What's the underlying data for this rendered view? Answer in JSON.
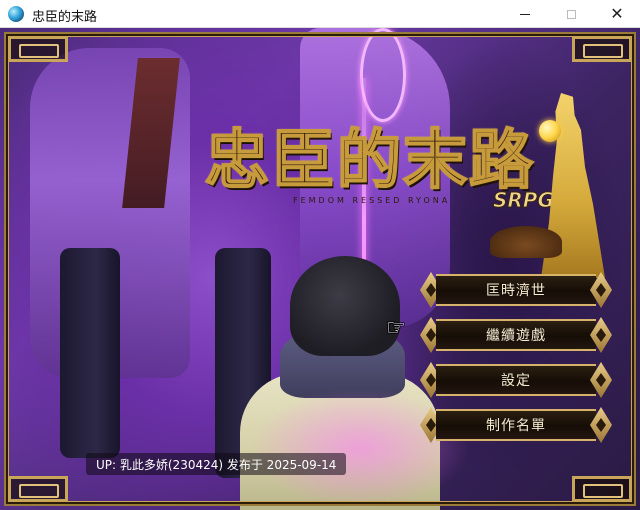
{
  "window": {
    "title": "忠臣的末路",
    "icon": "globe-icon"
  },
  "window_controls": {
    "minimize_icon": "minimize-icon",
    "maximize_icon": "maximize-icon",
    "close_icon": "close-icon",
    "close_glyph": "✕"
  },
  "logo": {
    "title": "忠臣的末路",
    "subtitle": "FEMDOM RESSED RYONA",
    "tag": "SRPG"
  },
  "menu": {
    "items": [
      {
        "label": "匡時濟世"
      },
      {
        "label": "繼續遊戲"
      },
      {
        "label": "設定"
      },
      {
        "label": "制作名單"
      }
    ],
    "selected_index": 1
  },
  "cursor": {
    "icon": "pointing-hand-icon",
    "glyph": "☞"
  },
  "notice": {
    "text": "UP: 乳此多娇(230424) 发布于 2025-09-14"
  },
  "colors": {
    "frame_gold": "#c9a55a",
    "menu_text": "#f4ead2",
    "menu_bg": "#150d06",
    "background_purple": "#6d3aa8",
    "rope_glow": "#ff66ff"
  }
}
